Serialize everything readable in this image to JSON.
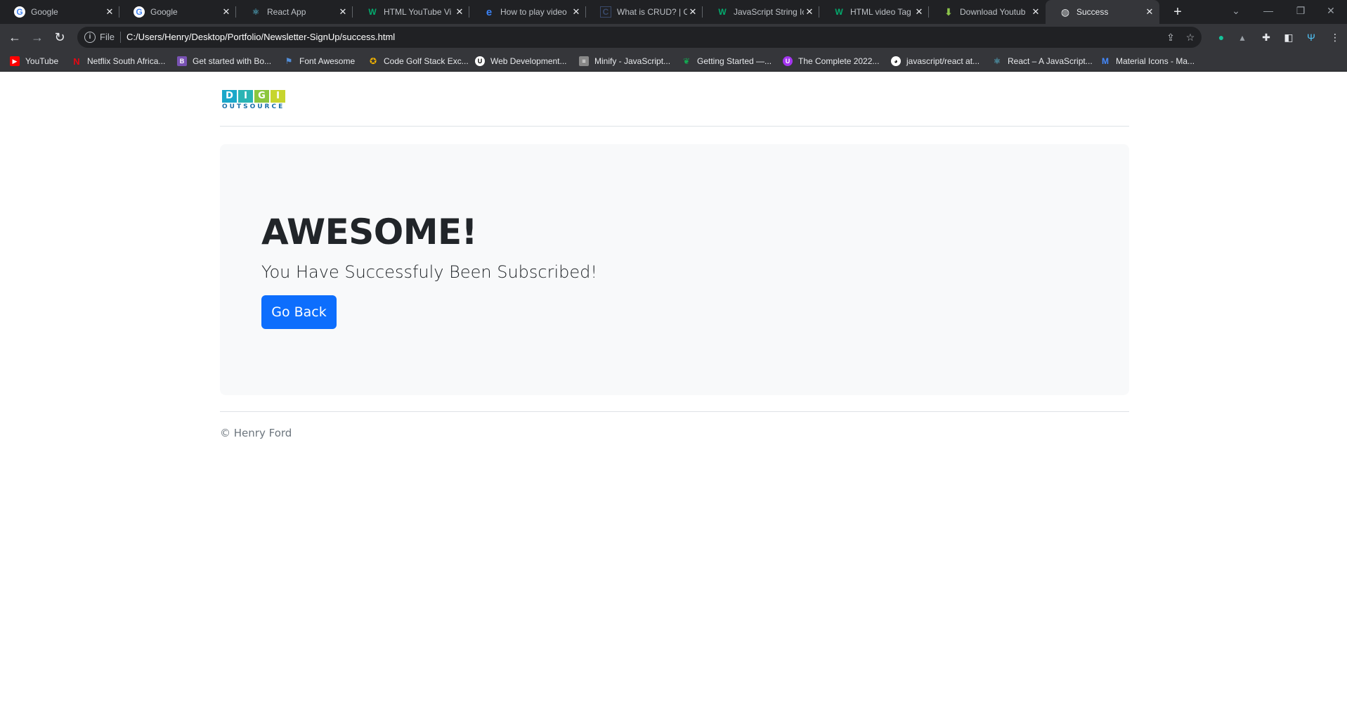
{
  "browser": {
    "tabs": [
      {
        "title": "Google",
        "icon": "google-icon",
        "active": false
      },
      {
        "title": "Google",
        "icon": "google-icon",
        "active": false
      },
      {
        "title": "React App",
        "icon": "react-icon",
        "active": false
      },
      {
        "title": "HTML YouTube Vi",
        "icon": "w3schools-icon",
        "active": false
      },
      {
        "title": "How to play video",
        "icon": "edge-icon",
        "active": false
      },
      {
        "title": "What is CRUD? | Co",
        "icon": "codecademy-icon",
        "active": false
      },
      {
        "title": "JavaScript String Ic",
        "icon": "w3schools-icon",
        "active": false
      },
      {
        "title": "HTML video Tag",
        "icon": "w3schools-icon",
        "active": false
      },
      {
        "title": "Download Youtub",
        "icon": "download-icon",
        "active": false
      },
      {
        "title": "Success",
        "icon": "globe-icon",
        "active": true
      }
    ],
    "tab_close_glyph": "✕",
    "new_tab_glyph": "+",
    "window_controls": {
      "tabsearch": "⌄",
      "minimize": "—",
      "restore": "❐",
      "close": "✕"
    },
    "nav": {
      "back": "←",
      "forward": "→",
      "reload": "↻"
    },
    "omnibox": {
      "scheme_label": "File",
      "url": "C:/Users/Henry/Desktop/Portfolio/Newsletter-SignUp/success.html"
    },
    "bookmarks": [
      {
        "label": "YouTube",
        "icon": "youtube-icon",
        "color": "#ff0000"
      },
      {
        "label": "Netflix South Africa...",
        "icon": "netflix-icon",
        "color": "#e50914"
      },
      {
        "label": "Get started with Bo...",
        "icon": "bootstrap-icon",
        "color": "#7952b3"
      },
      {
        "label": "Font Awesome",
        "icon": "flag-icon",
        "color": "#528dd7"
      },
      {
        "label": "Code Golf Stack Exc...",
        "icon": "medal-icon",
        "color": "#f4b400"
      },
      {
        "label": "Web Development...",
        "icon": "udemy-icon",
        "color": "#ffffff"
      },
      {
        "label": "Minify - JavaScript...",
        "icon": "minify-icon",
        "color": "#888888"
      },
      {
        "label": "Getting Started —...",
        "icon": "mongodb-icon",
        "color": "#13aa52"
      },
      {
        "label": "The Complete 2022...",
        "icon": "udemy-icon",
        "color": "#a435f0"
      },
      {
        "label": "javascript/react at...",
        "icon": "github-icon",
        "color": "#ffffff"
      },
      {
        "label": "React – A JavaScript...",
        "icon": "react-icon",
        "color": "#61dafb"
      },
      {
        "label": "Material Icons - Ma...",
        "icon": "material-icon",
        "color": "#448aff"
      }
    ]
  },
  "page": {
    "logo": {
      "letters": [
        "D",
        "I",
        "G",
        "I"
      ],
      "letter_colors": [
        "#1aa7c9",
        "#2ab4b4",
        "#8cc63f",
        "#c7d52e"
      ],
      "subtitle": "OUTSOURCE"
    },
    "hero": {
      "title": "AWESOME!",
      "text": "You Have Successfuly Been Subscribed!",
      "button": "Go Back"
    },
    "footer": "© Henry Ford"
  },
  "colors": {
    "primary": "#0d6efd",
    "jumbotron_bg": "#f8f9fa",
    "text": "#212529",
    "muted": "#6c757d"
  }
}
